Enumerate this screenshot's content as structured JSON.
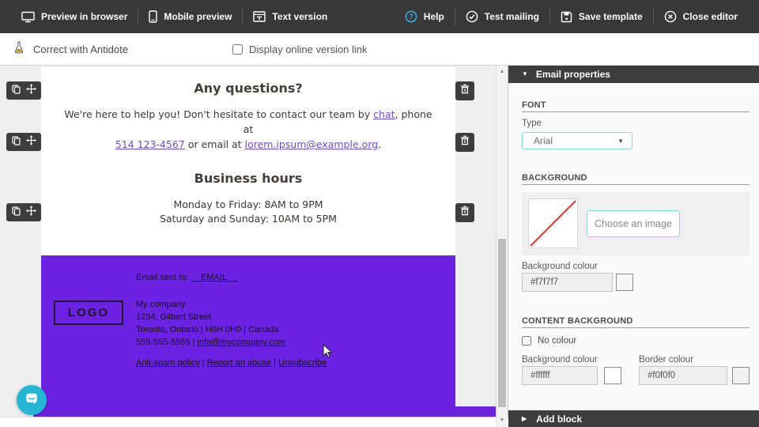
{
  "topbar": {
    "left": [
      {
        "icon": "monitor-icon",
        "label": "Preview in browser"
      },
      {
        "icon": "mobile-icon",
        "label": "Mobile preview"
      },
      {
        "icon": "text-version-icon",
        "label": "Text version"
      }
    ],
    "right": [
      {
        "icon": "help-icon",
        "label": "Help"
      },
      {
        "icon": "check-circle-icon",
        "label": "Test mailing"
      },
      {
        "icon": "save-icon",
        "label": "Save template"
      },
      {
        "icon": "close-circle-icon",
        "label": "Close editor"
      }
    ]
  },
  "subtoolbar": {
    "antidote_label": "Correct with Antidote",
    "online_version_label": "Display online version link"
  },
  "email": {
    "questions_heading": "Any questions?",
    "contact_pre": "We're here to help you! Don't hesitate to contact our team by ",
    "contact_chat_link": "chat",
    "contact_mid1": ", phone at",
    "contact_phone_link": "514 123-4567",
    "contact_mid2": " or email at ",
    "contact_email_link": "lorem.ipsum@example.org",
    "contact_end": ".",
    "hours_heading": "Business hours",
    "hours_line1": "Monday to Friday: 8AM to 9PM",
    "hours_line2": "Saturday and Sunday: 10AM to 5PM",
    "footer": {
      "sent_to_label": "Email sent to: ",
      "sent_to_value": "__EMAIL__",
      "logo_text": "LOGO",
      "company_name": "My company",
      "address_line1": "1234, Gilbert Street",
      "address_line2": "Toronto, Ontario | H0H 0H0 | Canada",
      "phone": "555-555-5555",
      "separator": " | ",
      "email_link": "info@mycompany.com",
      "link_antispam": "Anti-spam policy",
      "link_abuse": "Report an abuse",
      "link_unsubscribe": "Unsubscribe",
      "background_color": "#6c22e2"
    }
  },
  "panel": {
    "title": "Email properties",
    "font": {
      "section_label": "FONT",
      "type_label": "Type",
      "type_value": "Arial"
    },
    "background": {
      "section_label": "BACKGROUND",
      "choose_image_label": "Choose an image",
      "colour_label": "Background colour",
      "colour_value": "#f7f7f7"
    },
    "content_background": {
      "section_label": "CONTENT BACKGROUND",
      "no_colour_label": "No colour",
      "bg_colour_label": "Background colour",
      "bg_colour_value": "#ffffff",
      "border_colour_label": "Border colour",
      "border_colour_value": "#f0f0f0"
    },
    "add_block_label": "Add block"
  },
  "colors": {
    "topbar_bg": "#383838",
    "accent_cyan": "#8bd6e6",
    "help_blue": "#35b2e8",
    "footer_purple": "#6c22e2",
    "email_link": "#7249d6",
    "chat_fab": "#25b6d6"
  }
}
